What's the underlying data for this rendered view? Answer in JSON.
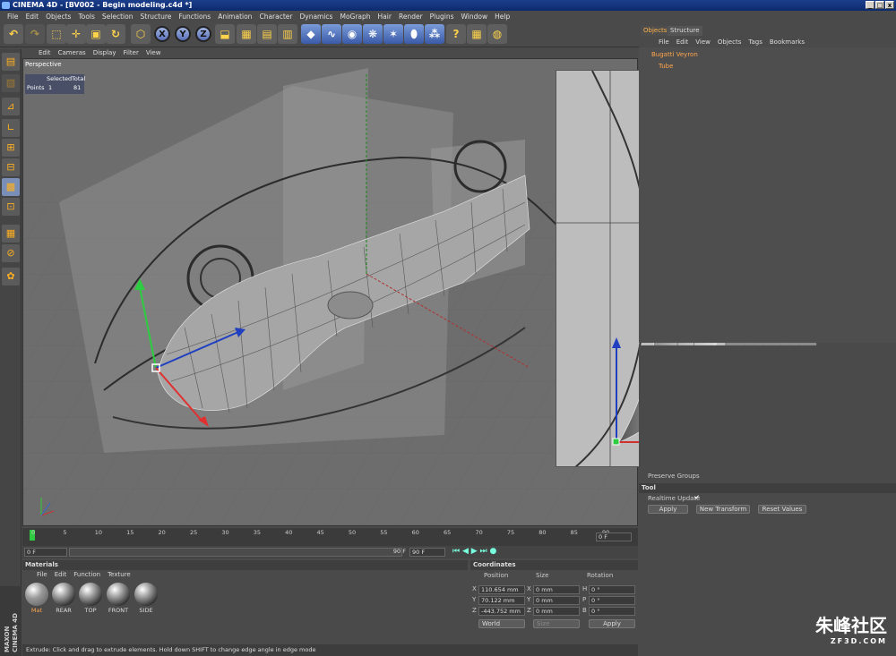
{
  "window": {
    "title": "CINEMA 4D - [BV002 - Begin modeling.c4d *]",
    "btns": [
      "_",
      "□",
      "x"
    ]
  },
  "menu": [
    "File",
    "Edit",
    "Objects",
    "Tools",
    "Selection",
    "Structure",
    "Functions",
    "Animation",
    "Character",
    "Dynamics",
    "MoGraph",
    "Hair",
    "Render",
    "Plugins",
    "Window",
    "Help"
  ],
  "toolbar": {
    "axis_x": "X",
    "axis_y": "Y",
    "axis_z": "Z"
  },
  "viewport": {
    "menu": [
      "Edit",
      "Cameras",
      "Display",
      "Filter",
      "View"
    ],
    "title": "Perspective",
    "hud": {
      "col_selected": "Selected",
      "col_total": "Total",
      "row_label": "Points",
      "selected": "1",
      "total": "81"
    }
  },
  "objects_panel": {
    "tabs": [
      "Objects",
      "Structure"
    ],
    "menu": [
      "File",
      "Edit",
      "View",
      "Objects",
      "Tags",
      "Bookmarks"
    ],
    "items": [
      "Bugatti Veyron",
      "Tube"
    ]
  },
  "attributes": {
    "preserve_groups": "Preserve Groups",
    "section_tool": "Tool",
    "realtime_update": "Realtime Update",
    "buttons": [
      "Apply",
      "New Transform",
      "Reset Values"
    ]
  },
  "timeline": {
    "ticks": [
      "0",
      "5",
      "10",
      "15",
      "20",
      "25",
      "30",
      "35",
      "40",
      "45",
      "50",
      "55",
      "60",
      "65",
      "70",
      "75",
      "80",
      "85",
      "90"
    ],
    "current": "0 F",
    "start": "0 F",
    "end": "90 F",
    "end2": "90 F"
  },
  "materials": {
    "title": "Materials",
    "menu": [
      "File",
      "Edit",
      "Function",
      "Texture"
    ],
    "items": [
      "Mat",
      "REAR",
      "TOP",
      "FRONT",
      "SIDE"
    ]
  },
  "coordinates": {
    "title": "Coordinates",
    "headers": [
      "Position",
      "Size",
      "Rotation"
    ],
    "rows": [
      {
        "axis": "X",
        "pos": "110.654 mm",
        "saxis": "X",
        "size": "0 mm",
        "raxis": "H",
        "rot": "0 °"
      },
      {
        "axis": "Y",
        "pos": "70.122 mm",
        "saxis": "Y",
        "size": "0 mm",
        "raxis": "P",
        "rot": "0 °"
      },
      {
        "axis": "Z",
        "pos": "-443.752 mm",
        "saxis": "Z",
        "size": "0 mm",
        "raxis": "B",
        "rot": "0 °"
      }
    ],
    "mode": "World",
    "size_mode": "Size",
    "apply": "Apply"
  },
  "status": "Extrude: Click and drag to extrude elements. Hold down SHIFT to change edge angle in edge mode",
  "maxon": {
    "line1": "MAXON",
    "line2": "CINEMA 4D"
  },
  "watermark": {
    "brand": "朱峰社区",
    "url": "ZF3D.COM"
  }
}
